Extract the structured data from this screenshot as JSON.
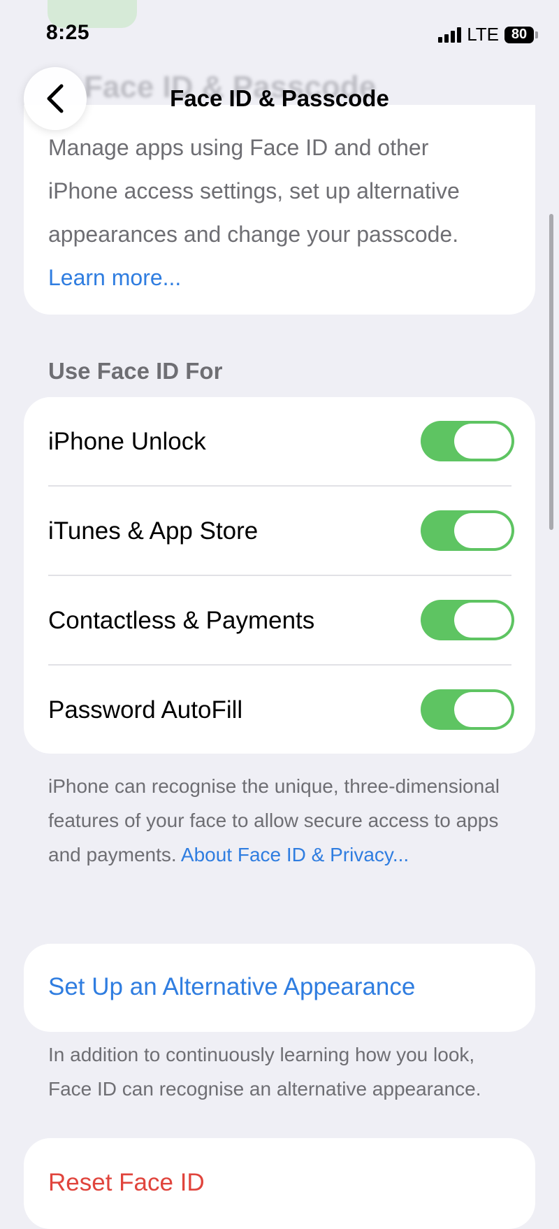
{
  "status_bar": {
    "time": "8:25",
    "network": "LTE",
    "battery": "80"
  },
  "nav": {
    "title": "Face ID & Passcode",
    "background_title": "Face ID & Passcode"
  },
  "intro": {
    "text": "Manage apps using Face ID and other iPhone access settings, set up alternative appearances and change your passcode. ",
    "link": "Learn more..."
  },
  "use_face_id_for": {
    "header": "Use Face ID For",
    "items": [
      {
        "label": "iPhone Unlock",
        "enabled": true
      },
      {
        "label": "iTunes & App Store",
        "enabled": true
      },
      {
        "label": "Contactless & Payments",
        "enabled": true
      },
      {
        "label": "Password AutoFill",
        "enabled": true
      }
    ]
  },
  "face_id_footnote": {
    "text": "iPhone can recognise the unique, three-dimensional features of your face to allow secure access to apps and payments. ",
    "link": "About Face ID & Privacy..."
  },
  "alternative_appearance": {
    "label": "Set Up an Alternative Appearance",
    "footnote": "In addition to continuously learning how you look, Face ID can recognise an alternative appearance."
  },
  "reset": {
    "label": "Reset Face ID"
  },
  "colors": {
    "background": "#efeff5",
    "link": "#2f7de0",
    "toggle_on": "#5ec462",
    "destructive": "#e0443c",
    "secondary_text": "#6e6e73"
  }
}
